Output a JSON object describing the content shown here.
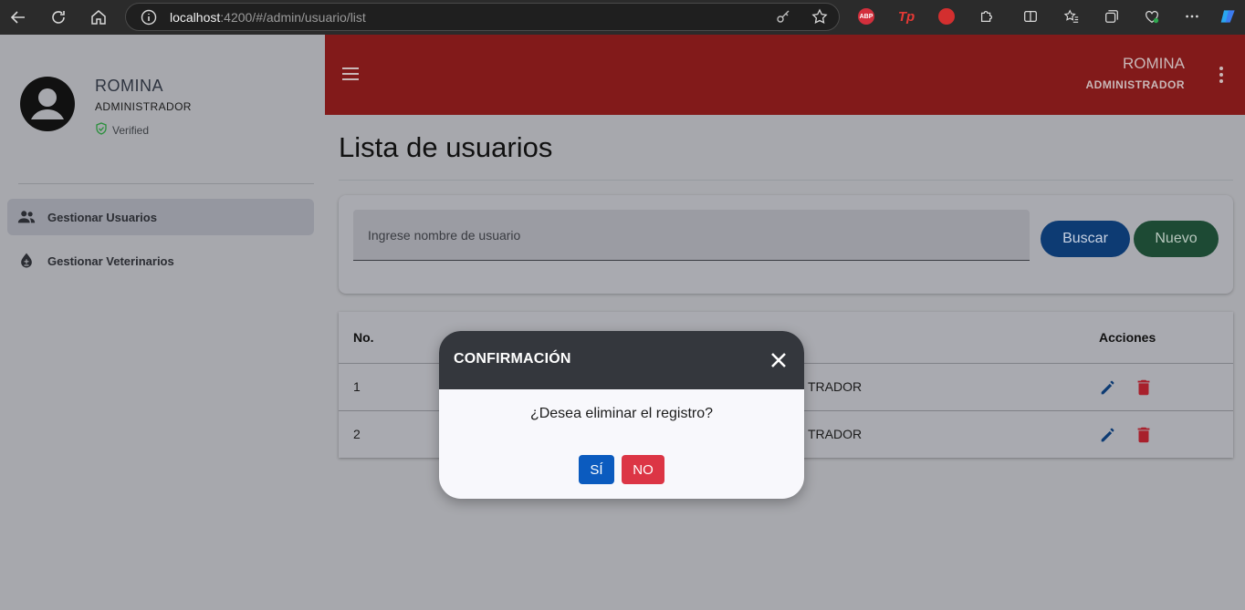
{
  "browser": {
    "url_host": "localhost",
    "url_path": ":4200/#/admin/usuario/list",
    "extensions": [
      "abp-icon",
      "tp-icon",
      "stop-icon",
      "puzzle-icon"
    ],
    "abp_label": "ABP",
    "tp_label": "Tp"
  },
  "sidebar": {
    "user_name": "ROMINA",
    "user_role": "ADMINISTRADOR",
    "verified_label": "Verified",
    "items": [
      {
        "label": "Gestionar Usuarios",
        "icon": "people-icon"
      },
      {
        "label": "Gestionar Veterinarios",
        "icon": "blood-drop-icon"
      }
    ]
  },
  "header": {
    "user_name": "ROMINA",
    "user_role": "ADMINISTRADOR"
  },
  "main": {
    "page_title": "Lista de usuarios",
    "search": {
      "placeholder": "Ingrese nombre de usuario",
      "search_label": "Buscar",
      "new_label": "Nuevo"
    },
    "table": {
      "headers": {
        "no": "No.",
        "actions": "Acciones"
      },
      "rows": [
        {
          "no": "1",
          "role_fragment": "TRADOR"
        },
        {
          "no": "2",
          "role_fragment": "TRADOR"
        }
      ]
    }
  },
  "modal": {
    "title": "CONFIRMACIÓN",
    "message": "¿Desea eliminar el registro?",
    "yes_label": "SÍ",
    "no_label": "NO"
  },
  "colors": {
    "header_bg": "#821a1a",
    "modal_header_bg": "#34373d",
    "yes_button": "#0b5bbf",
    "no_button": "#dc3545",
    "search_button": "#0d3b73",
    "new_button": "#1d4a34"
  }
}
